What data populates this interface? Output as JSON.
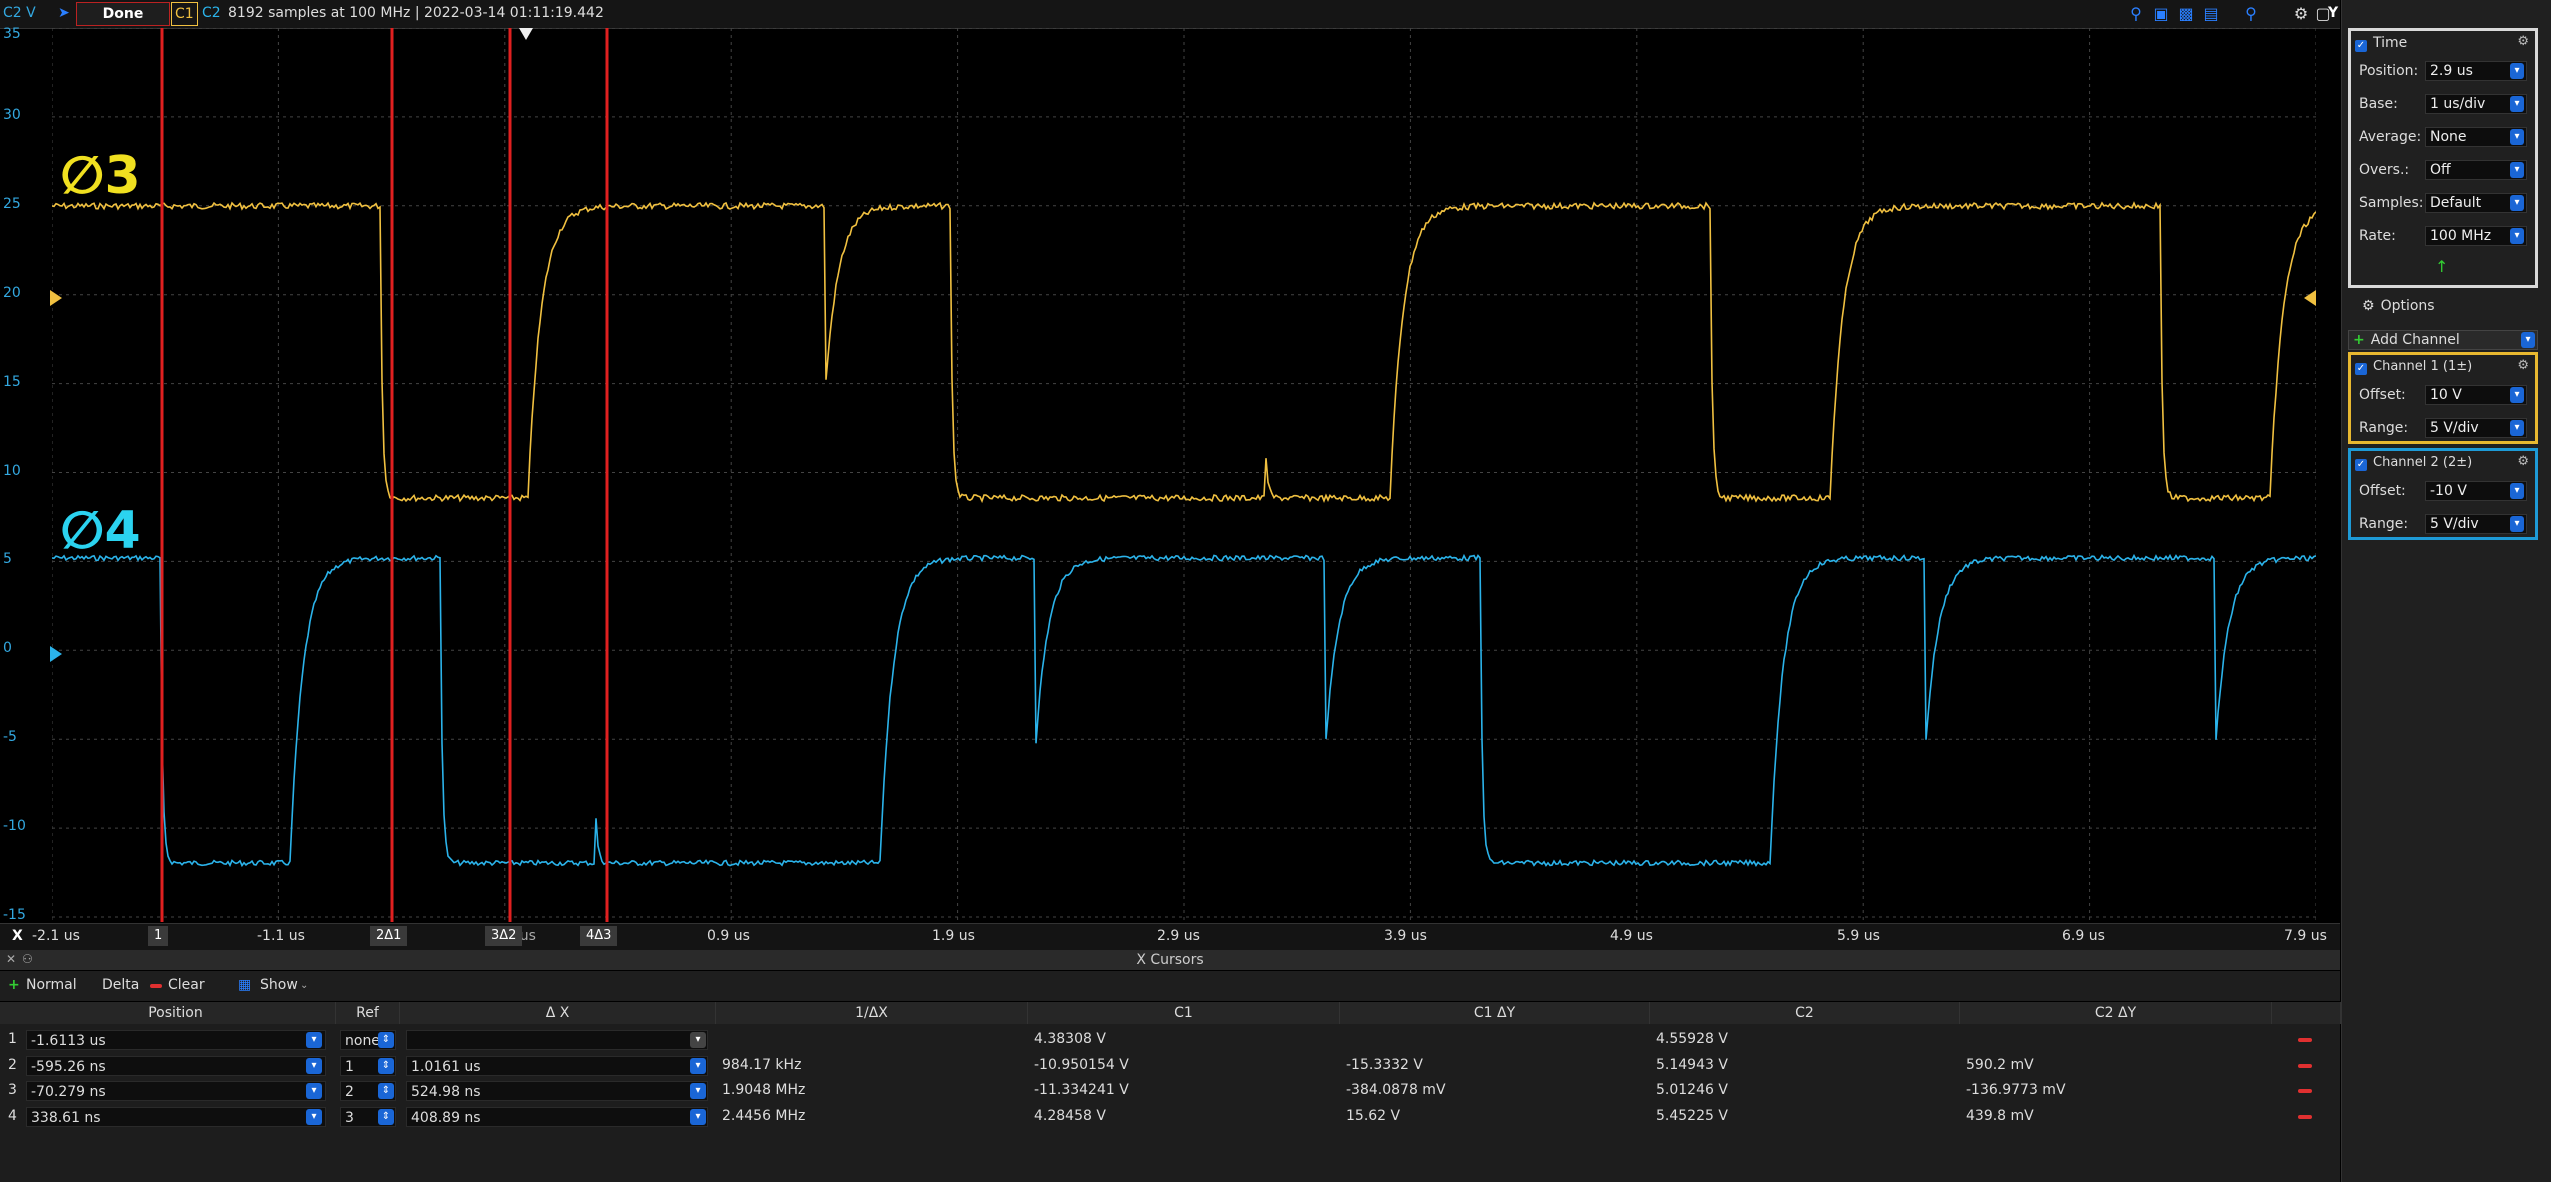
{
  "topbar": {
    "axis_label": "C2 V",
    "run_status": "Done",
    "ch1_tag": "C1",
    "ch2_tag": "C2",
    "info": "8192 samples at 100 MHz | 2022-03-14 01:11:19.442",
    "right_letter": "Y"
  },
  "plot": {
    "y_ticks": [
      "35",
      "30",
      "25",
      "20",
      "15",
      "10",
      "5",
      "0",
      "-5",
      "-10",
      "-15"
    ],
    "label_phase3": "∅3",
    "label_phase4": "∅4",
    "ch1_color": "#f0c040",
    "ch2_color": "#2bb3ea",
    "cursor_color": "#e02020"
  },
  "xaxis": {
    "label": "X",
    "ticks": [
      "-2.1 us",
      "-1.1 us",
      "0.9 us",
      "1.9 us",
      "2.9 us",
      "3.9 us",
      "4.9 us",
      "5.9 us",
      "6.9 us",
      "7.9 us"
    ],
    "cursor_flags": [
      "1",
      "2Δ1",
      "3Δ2",
      "4Δ3"
    ],
    "partial_tick": "-0.1 us"
  },
  "cursors_panel": {
    "title": "X Cursors",
    "toolbar": {
      "normal": "Normal",
      "delta": "Delta",
      "clear": "Clear",
      "show": "Show"
    },
    "columns": [
      "Position",
      "Ref",
      "Δ X",
      "1/ΔX",
      "C1",
      "C1 ΔY",
      "C2",
      "C2 ΔY"
    ],
    "rows": [
      {
        "n": "1",
        "position": "-1.6113 us",
        "ref": "none",
        "dx": "",
        "inv": "",
        "c1": "4.38308 V",
        "c1dy": "",
        "c2": "4.55928 V",
        "c2dy": ""
      },
      {
        "n": "2",
        "position": "-595.26 ns",
        "ref": "1",
        "dx": "1.0161 us",
        "inv": "984.17 kHz",
        "c1": "-10.950154 V",
        "c1dy": "-15.3332 V",
        "c2": "5.14943 V",
        "c2dy": "590.2 mV"
      },
      {
        "n": "3",
        "position": "-70.279 ns",
        "ref": "2",
        "dx": "524.98 ns",
        "inv": "1.9048 MHz",
        "c1": "-11.334241 V",
        "c1dy": "-384.0878 mV",
        "c2": "5.01246 V",
        "c2dy": "-136.9773 mV"
      },
      {
        "n": "4",
        "position": "338.61 ns",
        "ref": "3",
        "dx": "408.89 ns",
        "inv": "2.4456 MHz",
        "c1": "4.28458 V",
        "c1dy": "15.62 V",
        "c2": "5.45225 V",
        "c2dy": "439.8 mV"
      }
    ]
  },
  "time_panel": {
    "title": "Time",
    "fields": [
      {
        "label": "Position:",
        "value": "2.9 us"
      },
      {
        "label": "Base:",
        "value": "1 us/div"
      },
      {
        "label": "Average:",
        "value": "None"
      },
      {
        "label": "Overs.:",
        "value": "Off"
      },
      {
        "label": "Samples:",
        "value": "Default"
      },
      {
        "label": "Rate:",
        "value": "100 MHz"
      }
    ],
    "options_label": "Options",
    "add_channel_label": "Add Channel"
  },
  "channel1": {
    "title": "Channel 1 (1±)",
    "offset_label": "Offset:",
    "offset": "10 V",
    "range_label": "Range:",
    "range": "5 V/div",
    "color": "#e8b830"
  },
  "channel2": {
    "title": "Channel 2 (2±)",
    "offset_label": "Offset:",
    "offset": "-10 V",
    "range_label": "Range:",
    "range": "5 V/div",
    "color": "#1e9ad6"
  }
}
